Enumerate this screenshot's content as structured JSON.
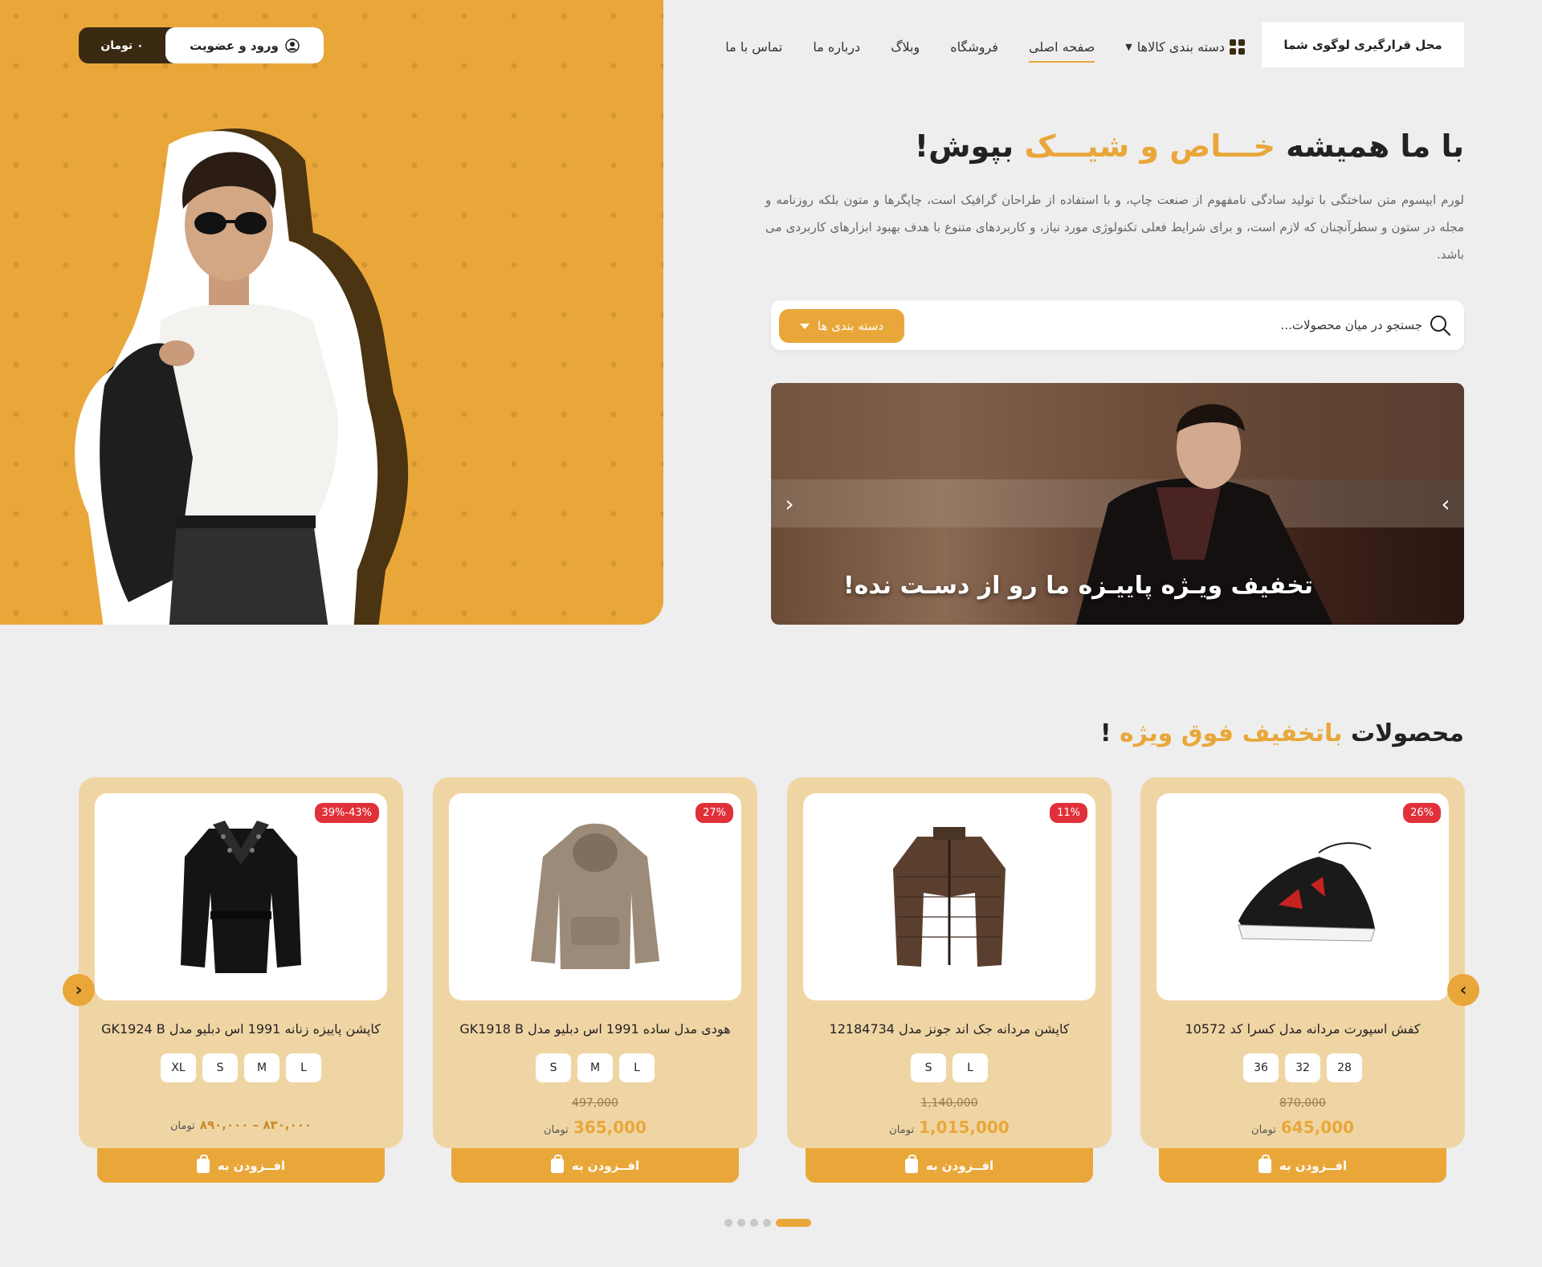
{
  "header": {
    "cart_amount": "۰ تومان",
    "login_label": "ورود و عضویت",
    "logo_text": "محل قرارگیری لوگوی شما"
  },
  "nav": {
    "categories": "دسته بندی کالاها",
    "home": "صفحه اصلی",
    "shop": "فروشگاه",
    "blog": "وبلاگ",
    "about": "درباره ما",
    "contact": "تماس با ما"
  },
  "hero": {
    "title_prefix": "با ما همیشه",
    "title_accent": "خـــاص و شیـــک",
    "title_suffix": "بپوش!",
    "description": "لورم ایپسوم متن ساختگی با تولید سادگی نامفهوم از صنعت چاپ، و با استفاده از طراحان گرافیک است، چاپگرها و متون بلکه روزنامه و مجله در ستون و سطرآنچنان که لازم است، و برای شرایط فعلی تکنولوژی مورد نیاز، و کاربردهای متنوع با هدف بهبود ابزارهای کاربردی می باشد."
  },
  "search": {
    "placeholder": "جستجو در میان محصولات...",
    "category_label": "دسته بندی ها"
  },
  "slider": {
    "caption": "تخفیف ویـژه پاییـزه ما رو از دسـت نده!"
  },
  "section": {
    "title_prefix": "محصولات",
    "title_accent": "باتخفیف فوق ویژه",
    "title_suffix": "!"
  },
  "products": [
    {
      "title": "کفش اسپورت مردانه مدل کسرا کد 10572",
      "badge": "26%",
      "sizes": [
        "28",
        "32",
        "36"
      ],
      "old_price": "870,000",
      "price": "645,000",
      "currency": "تومان",
      "image": "sneaker-icon"
    },
    {
      "title": "کاپشن مردانه جک اند جونز مدل 12184734",
      "badge": "11%",
      "sizes": [
        "L",
        "S"
      ],
      "old_price": "1,140,000",
      "price": "1,015,000",
      "currency": "تومان",
      "image": "puffer-jacket-icon"
    },
    {
      "title": "هودی مدل ساده 1991 اس دبلیو مدل GK1918 B",
      "badge": "27%",
      "sizes": [
        "L",
        "M",
        "S"
      ],
      "old_price": "497,000",
      "price": "365,000",
      "currency": "تومان",
      "image": "hoodie-icon"
    },
    {
      "title": "کاپشن پاییزه زنانه 1991 اس دبلیو مدل GK1924 B",
      "badge": "39%-43%",
      "sizes": [
        "L",
        "M",
        "S",
        "XL"
      ],
      "old_price": "",
      "price": "۸۳۰,۰۰۰ – ۸۹۰,۰۰۰",
      "currency": "تومان",
      "image": "coat-icon"
    }
  ],
  "add_to_cart": "افــزودن به",
  "colors": {
    "accent": "#e9a73a",
    "dark": "#3a2a12",
    "card_bg": "#f0d5a4",
    "badge": "#e0313a"
  }
}
